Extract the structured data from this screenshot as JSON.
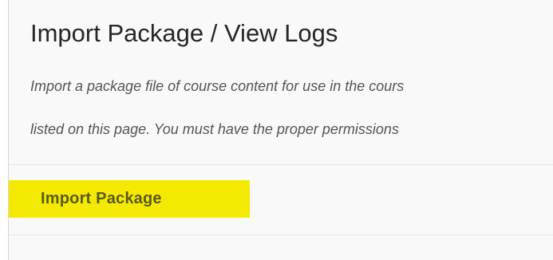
{
  "header": {
    "title": "Import Package / View Logs",
    "description_lines": [
      "Import a package file of course content for use in the cours",
      "listed on this page. You must have the proper permissions"
    ]
  },
  "actions": {
    "import_package_label": "Import Package"
  },
  "colors": {
    "highlight": "#f4e900",
    "background": "#f9f9f9",
    "title_text": "#262626",
    "description_text": "#555555"
  }
}
